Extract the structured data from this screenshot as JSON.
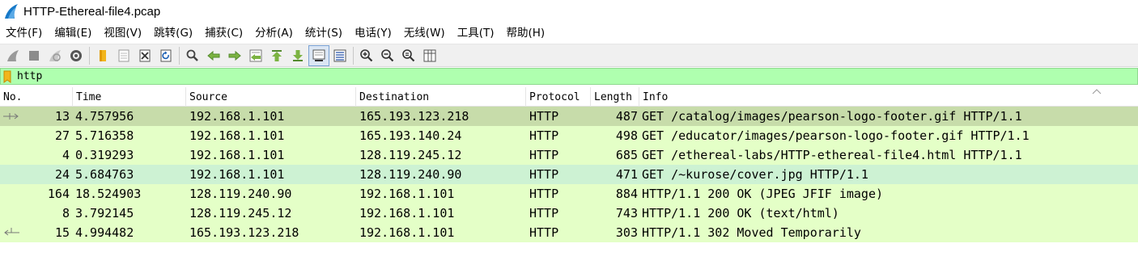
{
  "window": {
    "title": "HTTP-Ethereal-file4.pcap"
  },
  "menu": [
    "文件(F)",
    "编辑(E)",
    "视图(V)",
    "跳转(G)",
    "捕获(C)",
    "分析(A)",
    "统计(S)",
    "电话(Y)",
    "无线(W)",
    "工具(T)",
    "帮助(H)"
  ],
  "toolbar": {
    "icons": [
      "shark-fin-start-icon",
      "stop-square-icon",
      "restart-fin-icon",
      "capture-options-gear-icon",
      "open-folder-icon",
      "file-icon",
      "close-file-icon",
      "reload-icon",
      "find-magnifier-icon",
      "go-back-arrow-icon",
      "go-forward-arrow-icon",
      "go-to-packet-icon",
      "first-packet-icon",
      "last-packet-icon",
      "autoscroll-icon",
      "colorize-icon",
      "zoom-in-icon",
      "zoom-out-icon",
      "zoom-normal-icon",
      "resize-columns-icon"
    ],
    "pressed": [
      "autoscroll-icon"
    ]
  },
  "filter": {
    "value": "http",
    "background": "#afffaf"
  },
  "packet_list": {
    "columns": [
      "No.",
      "Time",
      "Source",
      "Destination",
      "Protocol",
      "Length",
      "Info"
    ],
    "rows": [
      {
        "no": "13",
        "time": "4.757956",
        "source": "192.168.1.101",
        "destination": "165.193.123.218",
        "protocol": "HTTP",
        "length": "487",
        "info": "GET /catalog/images/pearson-logo-footer.gif HTTP/1.1",
        "bg": "#c7dcaa",
        "related": "request"
      },
      {
        "no": "27",
        "time": "5.716358",
        "source": "192.168.1.101",
        "destination": "165.193.140.24",
        "protocol": "HTTP",
        "length": "498",
        "info": "GET /educator/images/pearson-logo-footer.gif HTTP/1.1",
        "bg": "#e4ffc7",
        "related": ""
      },
      {
        "no": "4",
        "time": "0.319293",
        "source": "192.168.1.101",
        "destination": "128.119.245.12",
        "protocol": "HTTP",
        "length": "685",
        "info": "GET /ethereal-labs/HTTP-ethereal-file4.html HTTP/1.1",
        "bg": "#e4ffc7",
        "related": ""
      },
      {
        "no": "24",
        "time": "5.684763",
        "source": "192.168.1.101",
        "destination": "128.119.240.90",
        "protocol": "HTTP",
        "length": "471",
        "info": "GET /~kurose/cover.jpg HTTP/1.1",
        "bg": "#cdf2d3",
        "related": ""
      },
      {
        "no": "164",
        "time": "18.524903",
        "source": "128.119.240.90",
        "destination": "192.168.1.101",
        "protocol": "HTTP",
        "length": "884",
        "info": "HTTP/1.1 200 OK  (JPEG JFIF image)",
        "bg": "#e4ffc7",
        "related": ""
      },
      {
        "no": "8",
        "time": "3.792145",
        "source": "128.119.245.12",
        "destination": "192.168.1.101",
        "protocol": "HTTP",
        "length": "743",
        "info": "HTTP/1.1 200 OK  (text/html)",
        "bg": "#e4ffc7",
        "related": ""
      },
      {
        "no": "15",
        "time": "4.994482",
        "source": "165.193.123.218",
        "destination": "192.168.1.101",
        "protocol": "HTTP",
        "length": "303",
        "info": "HTTP/1.1 302 Moved Temporarily",
        "bg": "#e4ffc7",
        "related": "response"
      }
    ]
  },
  "colors": {
    "selected_row": "#c7dcaa",
    "http_row": "#e4ffc7",
    "highlight_row": "#cdf2d3",
    "filter_ok": "#afffaf"
  }
}
